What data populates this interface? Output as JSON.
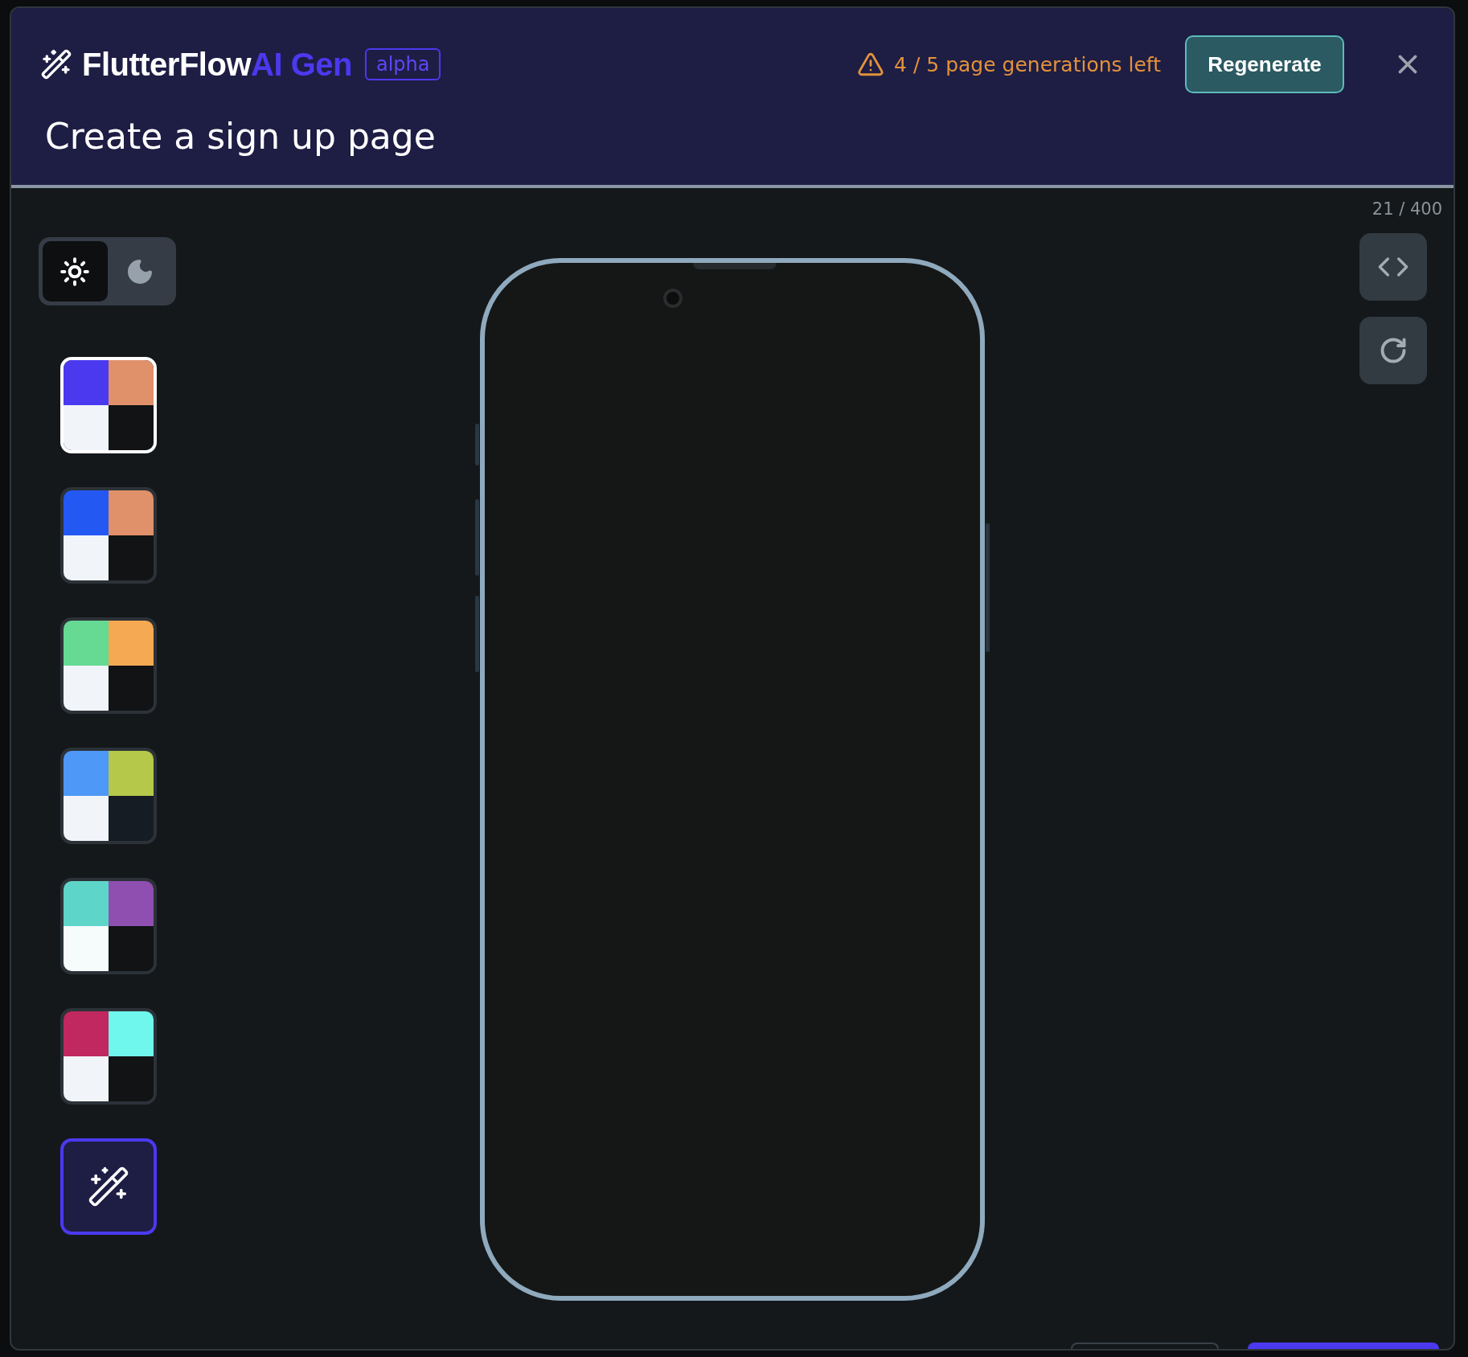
{
  "header": {
    "brand": "FlutterFlow",
    "brand_accent": "AI Gen",
    "badge": "alpha",
    "warning": "4 / 5 page generations left",
    "regenerate_button": "Regenerate"
  },
  "prompt": "Create a sign up page",
  "counter": "21 / 400",
  "theme_toggle": [
    {
      "kind": "light",
      "selected": true
    },
    {
      "kind": "dark",
      "selected": false
    }
  ],
  "palettes": [
    {
      "kind": "swatch",
      "selected": true,
      "quadrants": [
        {
          "color": "#4b39ef"
        },
        {
          "color": "#e0916a"
        },
        {
          "color": "#f1f4f8"
        },
        {
          "color": "#111315"
        }
      ]
    },
    {
      "kind": "swatch",
      "selected": false,
      "quadrants": [
        {
          "color": "#2458f2"
        },
        {
          "color": "#e0916a"
        },
        {
          "color": "#f1f4f8"
        },
        {
          "color": "#111315"
        }
      ]
    },
    {
      "kind": "swatch",
      "selected": false,
      "quadrants": [
        {
          "color": "#66d993"
        },
        {
          "color": "#f4a952"
        },
        {
          "color": "#f1f4f8"
        },
        {
          "color": "#111315"
        }
      ]
    },
    {
      "kind": "swatch",
      "selected": false,
      "quadrants": [
        {
          "color": "#4e98f8"
        },
        {
          "color": "#b5c84a"
        },
        {
          "color": "#f1f4f8"
        },
        {
          "color": "#151c24"
        }
      ]
    },
    {
      "kind": "swatch",
      "selected": false,
      "quadrants": [
        {
          "color": "#5ed5c9"
        },
        {
          "color": "#8e4fb0"
        },
        {
          "color": "#f5fcfb"
        },
        {
          "color": "#111315"
        }
      ]
    },
    {
      "kind": "swatch",
      "selected": false,
      "quadrants": [
        {
          "color": "#c0285f"
        },
        {
          "color": "#6ff7ee"
        },
        {
          "color": "#f1f4f8"
        },
        {
          "color": "#111315"
        }
      ]
    },
    {
      "kind": "magic",
      "selected": false
    }
  ]
}
